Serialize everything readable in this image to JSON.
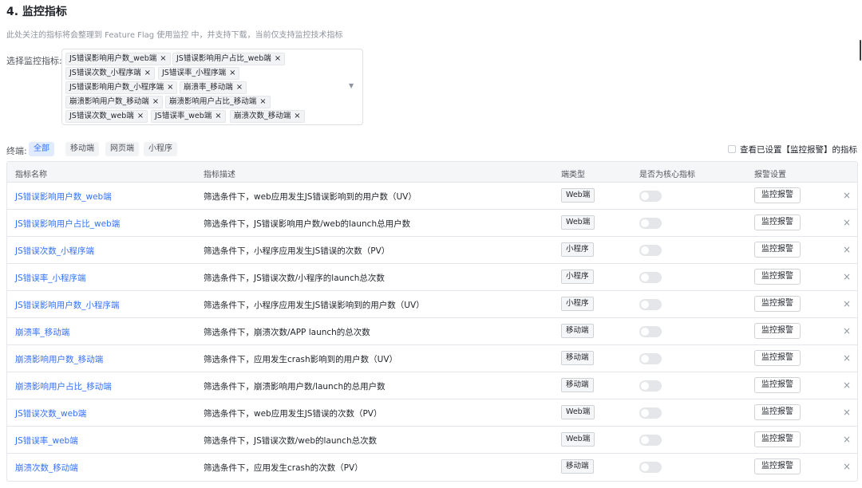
{
  "section": {
    "title": "4. 监控指标",
    "subtitle": "此处关注的指标将会整理到 Feature Flag 使用监控 中，并支持下载，当前仅支持监控技术指标"
  },
  "select": {
    "label": "选择监控指标:",
    "tags": [
      "JS错误影响用户数_web端",
      "JS错误影响用户占比_web端",
      "JS错误次数_小程序端",
      "JS错误率_小程序端",
      "JS错误影响用户数_小程序端",
      "崩溃率_移动端",
      "崩溃影响用户数_移动端",
      "崩溃影响用户占比_移动端",
      "JS错误次数_web端",
      "JS错误率_web端",
      "崩溃次数_移动端"
    ],
    "tag_remove": "×",
    "caret": "▼"
  },
  "filters": {
    "label": "终端:",
    "options": [
      "全部",
      "移动端",
      "网页端",
      "小程序"
    ],
    "active": "全部",
    "checkbox_label": "查看已设置【监控报警】的指标"
  },
  "table": {
    "headers": [
      "指标名称",
      "指标描述",
      "端类型",
      "是否为核心指标",
      "报警设置"
    ],
    "alarm_label": "监控报警",
    "remove": "×",
    "rows": [
      {
        "name": "JS错误影响用户数_web端",
        "desc": "筛选条件下，web应用发生JS错误影响到的用户数（UV）",
        "type": "Web端"
      },
      {
        "name": "JS错误影响用户占比_web端",
        "desc": "筛选条件下，JS错误影响用户数/web的launch总用户数",
        "type": "Web端"
      },
      {
        "name": "JS错误次数_小程序端",
        "desc": "筛选条件下，小程序应用发生JS错误的次数（PV）",
        "type": "小程序"
      },
      {
        "name": "JS错误率_小程序端",
        "desc": "筛选条件下，JS错误次数/小程序的launch总次数",
        "type": "小程序"
      },
      {
        "name": "JS错误影响用户数_小程序端",
        "desc": "筛选条件下，小程序应用发生JS错误影响到的用户数（UV）",
        "type": "小程序"
      },
      {
        "name": "崩溃率_移动端",
        "desc": "筛选条件下，崩溃次数/APP launch的总次数",
        "type": "移动端"
      },
      {
        "name": "崩溃影响用户数_移动端",
        "desc": "筛选条件下，应用发生crash影响到的用户数（UV）",
        "type": "移动端"
      },
      {
        "name": "崩溃影响用户占比_移动端",
        "desc": "筛选条件下，崩溃影响用户数/launch的总用户数",
        "type": "移动端"
      },
      {
        "name": "JS错误次数_web端",
        "desc": "筛选条件下，web应用发生JS错误的次数（PV）",
        "type": "Web端"
      },
      {
        "name": "JS错误率_web端",
        "desc": "筛选条件下，JS错误次数/web的launch总次数",
        "type": "Web端"
      },
      {
        "name": "崩溃次数_移动端",
        "desc": "筛选条件下，应用发生crash的次数（PV）",
        "type": "移动端"
      }
    ]
  },
  "colors": {
    "accent": "#3370ff",
    "border": "#e5e6eb",
    "header_bg": "#f5f6f7"
  }
}
